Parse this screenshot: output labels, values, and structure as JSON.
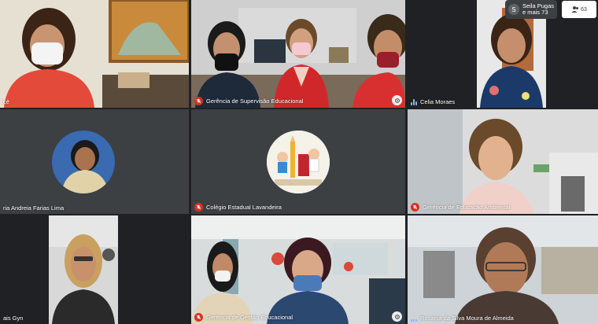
{
  "top_bar": {
    "avatar_letter": "S",
    "participants_text_1": "Seila Pugas",
    "participants_text_2": "e mais 73",
    "people_count": "63"
  },
  "tiles": [
    {
      "label": "cê",
      "mic": "none"
    },
    {
      "label": "Gerência de Supervisão Educacional",
      "mic": "muted"
    },
    {
      "label": "Celia Moraes",
      "mic": "speaking"
    },
    {
      "label": "ria Andreia Farias Lima",
      "mic": "none"
    },
    {
      "label": "Colégio Estadual Lavandeira",
      "mic": "muted"
    },
    {
      "label": "Gerência de Educação Ambiental",
      "mic": "muted"
    },
    {
      "label": "ais Gyn",
      "mic": "none"
    },
    {
      "label": "Gerência de Gestão Educacional",
      "mic": "muted"
    },
    {
      "label": "Rosania da Silva Moura de Almeida",
      "mic": "speaking"
    }
  ]
}
